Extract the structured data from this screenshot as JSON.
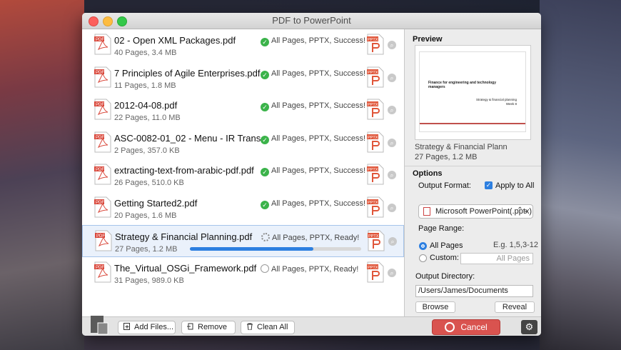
{
  "window": {
    "title": "PDF to PowerPoint"
  },
  "files": [
    {
      "name": "02 - Open XML Packages.pdf",
      "meta": "40 Pages, 3.4 MB",
      "status": "All Pages, PPTX, Success!",
      "state": "success"
    },
    {
      "name": "7 Principles of Agile Enterprises.pdf",
      "meta": "11 Pages, 1.8 MB",
      "status": "All Pages, PPTX, Success!",
      "state": "success"
    },
    {
      "name": "2012-04-08.pdf",
      "meta": "22 Pages, 11.0 MB",
      "status": "All Pages, PPTX, Success!",
      "state": "success"
    },
    {
      "name": "ASC-0082-01_02 - Menu - IR Trans...",
      "meta": "2 Pages, 357.0 KB",
      "status": "All Pages, PPTX, Success!",
      "state": "success"
    },
    {
      "name": "extracting-text-from-arabic-pdf.pdf",
      "meta": "26 Pages, 510.0 KB",
      "status": "All Pages, PPTX, Success!",
      "state": "success"
    },
    {
      "name": "Getting Started2.pdf",
      "meta": "20 Pages, 1.6 MB",
      "status": "All Pages, PPTX, Success!",
      "state": "success"
    },
    {
      "name": "Strategy & Financial Planning.pdf",
      "meta": "27 Pages, 1.2 MB",
      "status": "All Pages, PPTX, Ready!",
      "state": "converting",
      "progress": 0.72
    },
    {
      "name": "The_Virtual_OSGi_Framework.pdf",
      "meta": "31 Pages, 989.0 KB",
      "status": "All Pages, PPTX, Ready!",
      "state": "waiting"
    }
  ],
  "icons": {
    "pdf_label": "PDF",
    "pptx_label": "PPTX"
  },
  "preview": {
    "heading": "Preview",
    "slide_title": "Finance for engineering and technology managers",
    "slide_subtitle": "Strategy & financial planning",
    "slide_week": "Week 8",
    "name": "Strategy & Financial Plann",
    "meta": "27 Pages, 1.2 MB"
  },
  "options": {
    "heading": "Options",
    "output_format_label": "Output Format:",
    "apply_all_label": "Apply to All",
    "apply_all_checked": true,
    "format_value": "Microsoft PowerPoint(.pptx)",
    "page_range_label": "Page Range:",
    "all_pages_label": "All Pages",
    "range_hint": "E.g. 1,5,3-12",
    "custom_label": "Custom:",
    "custom_placeholder": "All Pages",
    "output_dir_label": "Output Directory:",
    "output_dir_value": "/Users/James/Documents",
    "browse_label": "Browse",
    "reveal_label": "Reveal"
  },
  "bottom": {
    "add_files_label": "Add Files...",
    "remove_label": "Remove",
    "clean_all_label": "Clean All",
    "cancel_label": "Cancel"
  },
  "colors": {
    "accent": "#2d7fe0",
    "success": "#3bb34a",
    "cancel": "#d9534f",
    "pdf_red": "#d9483b"
  }
}
